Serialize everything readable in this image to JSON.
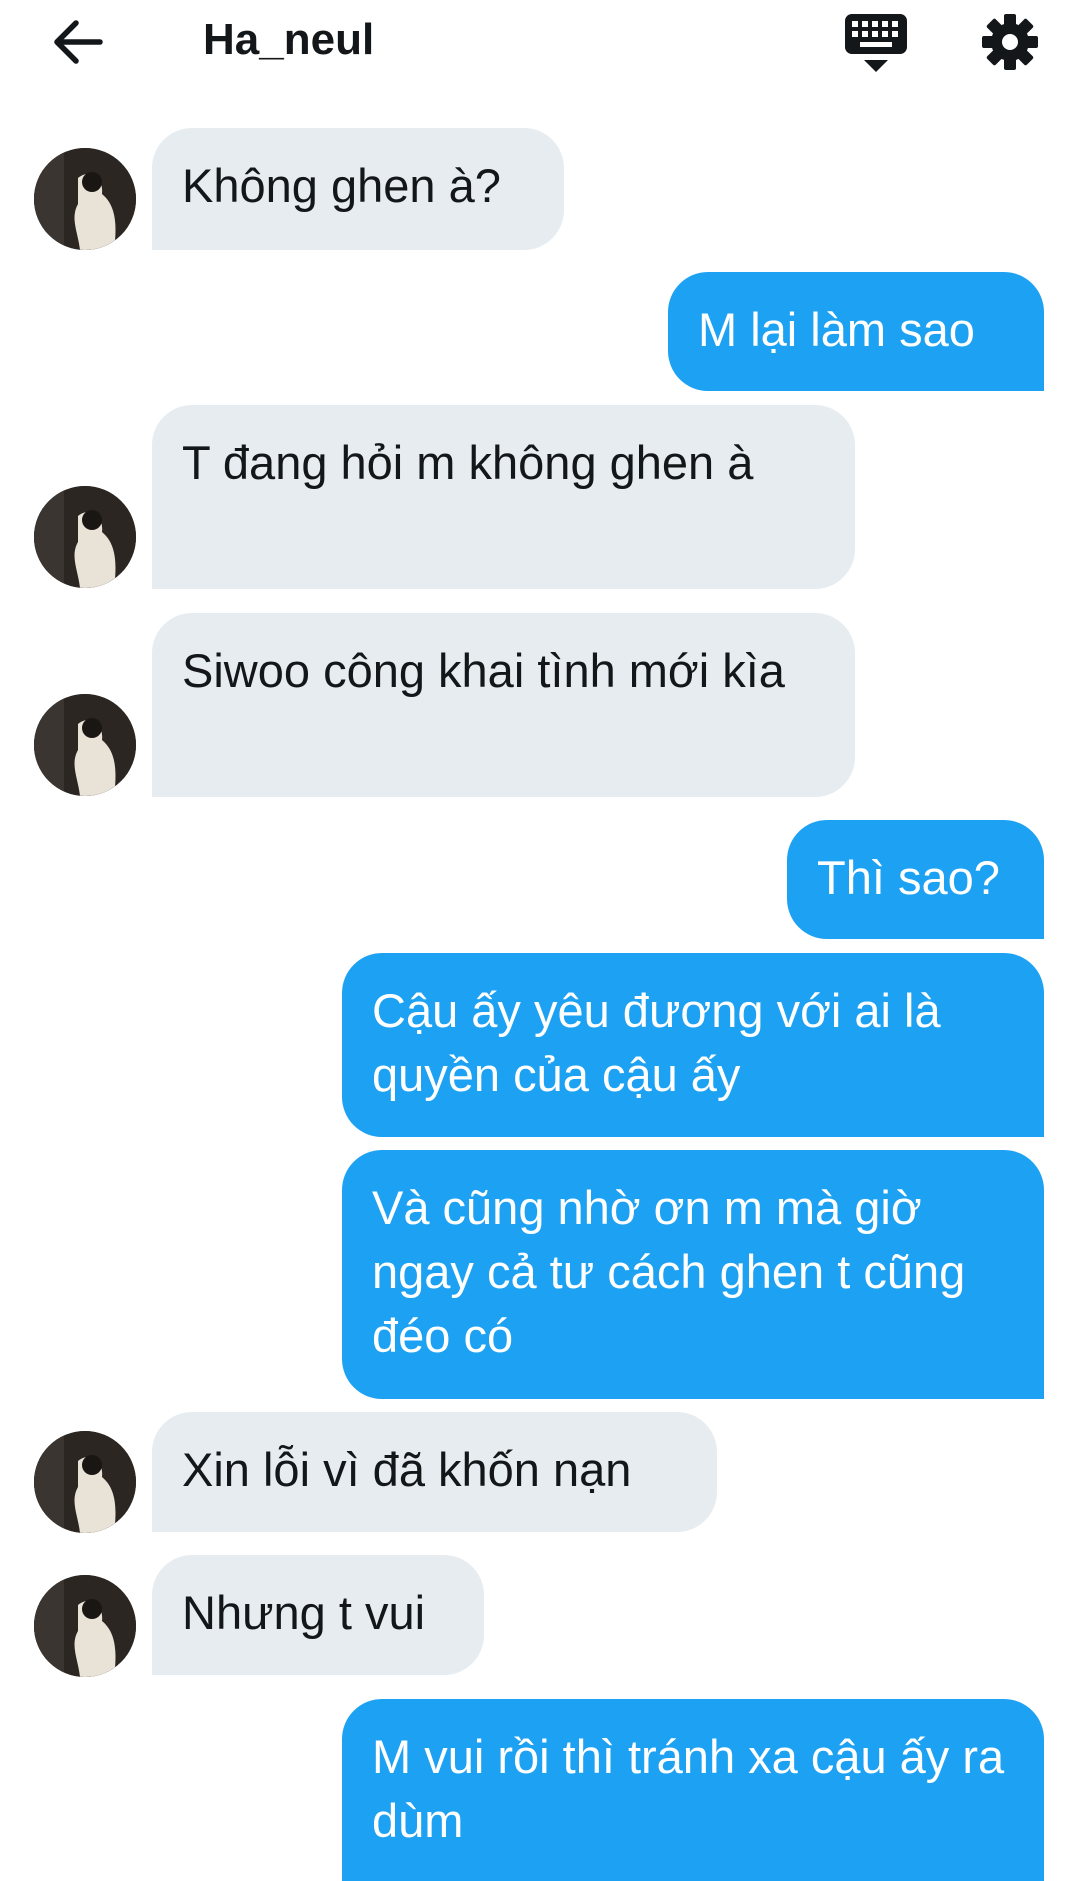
{
  "header": {
    "title": "Ha_neul",
    "back_icon": "arrow-left-icon",
    "keyboard_icon": "keyboard-icon",
    "settings_icon": "gear-icon"
  },
  "colors": {
    "outgoing_bubble": "#1da1f2",
    "incoming_bubble": "#e6ecf0",
    "text": "#14171a"
  },
  "messages": [
    {
      "direction": "in",
      "text": "Không ghen à?"
    },
    {
      "direction": "out",
      "text": "M lại làm sao"
    },
    {
      "direction": "in",
      "text": "T đang hỏi m không ghen à"
    },
    {
      "direction": "in",
      "text": "Siwoo công khai tình mới kìa"
    },
    {
      "direction": "out",
      "text": "Thì sao?"
    },
    {
      "direction": "out",
      "text": "Cậu ấy yêu đương với ai là quyền của cậu ấy"
    },
    {
      "direction": "out",
      "text": "Và cũng nhờ ơn m mà giờ ngay cả tư cách ghen t cũng đéo có"
    },
    {
      "direction": "in",
      "text": "Xin lỗi vì đã khốn nạn"
    },
    {
      "direction": "in",
      "text": "Nhưng t vui"
    },
    {
      "direction": "out",
      "text": "M vui rồi thì tránh xa cậu ấy ra dùm"
    }
  ]
}
